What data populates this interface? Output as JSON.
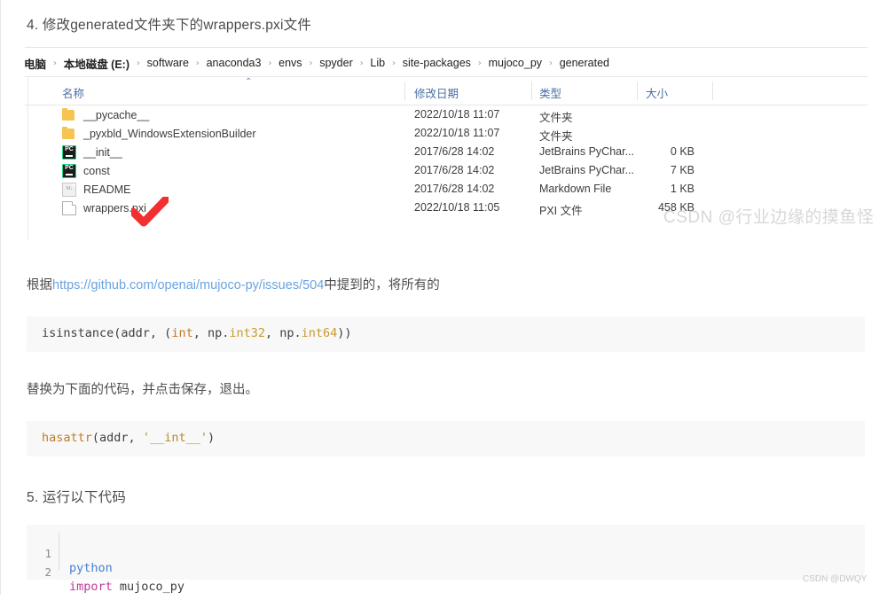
{
  "headings": {
    "step4": "4. 修改generated文件夹下的wrappers.pxi文件",
    "step5": "5. 运行以下代码"
  },
  "explorer": {
    "breadcrumb": {
      "root": "电脑",
      "separator": "›",
      "items": [
        "本地磁盘 (E:)",
        "software",
        "anaconda3",
        "envs",
        "spyder",
        "Lib",
        "site-packages",
        "mujoco_py",
        "generated"
      ]
    },
    "columns": {
      "name": "名称",
      "date": "修改日期",
      "type": "类型",
      "size": "大小",
      "sort_caret": "⌃"
    },
    "rows": [
      {
        "icon": "folder-icon",
        "name": "__pycache__",
        "date": "2022/10/18 11:07",
        "type": "文件夹",
        "size": ""
      },
      {
        "icon": "folder-icon",
        "name": "_pyxbld_WindowsExtensionBuilder",
        "date": "2022/10/18 11:07",
        "type": "文件夹",
        "size": ""
      },
      {
        "icon": "pycharm-file-icon",
        "name": "__init__",
        "date": "2017/6/28 14:02",
        "type": "JetBrains PyChar...",
        "size": "0 KB"
      },
      {
        "icon": "pycharm-file-icon",
        "name": "const",
        "date": "2017/6/28 14:02",
        "type": "JetBrains PyChar...",
        "size": "7 KB"
      },
      {
        "icon": "markdown-file-icon",
        "name": "README",
        "date": "2017/6/28 14:02",
        "type": "Markdown File",
        "size": "1 KB"
      },
      {
        "icon": "generic-file-icon",
        "name": "wrappers.pxi",
        "date": "2022/10/18 11:05",
        "type": "PXI 文件",
        "size": "458 KB"
      }
    ],
    "annotation_color": "#f23030"
  },
  "paragraphs": {
    "link_line": {
      "prefix": "根据",
      "link_text": "https://github.com/openai/mujoco-py/issues/504",
      "suffix": "中提到的，将所有的",
      "link_color": "#6aa3e0"
    },
    "replace_line": "替换为下面的代码，并点击保存，退出。"
  },
  "code_blocks": {
    "original": {
      "tokens": [
        {
          "text": "isinstance(addr, (",
          "style": "plain"
        },
        {
          "text": "int",
          "style": "builtin"
        },
        {
          "text": ", np.",
          "style": "plain"
        },
        {
          "text": "int32",
          "style": "num"
        },
        {
          "text": ", np.",
          "style": "plain"
        },
        {
          "text": "int64",
          "style": "num"
        },
        {
          "text": "))",
          "style": "plain"
        }
      ],
      "plain_text": "isinstance(addr, (int, np.int32, np.int64))"
    },
    "replacement": {
      "tokens": [
        {
          "text": "hasattr",
          "style": "func"
        },
        {
          "text": "(addr, ",
          "style": "plain"
        },
        {
          "text": "'__int__'",
          "style": "str"
        },
        {
          "text": ")",
          "style": "plain"
        }
      ],
      "plain_text": "hasattr(addr, '__int__')"
    },
    "run": {
      "lines": [
        {
          "number": "1",
          "tokens": [
            {
              "text": "python",
              "style": "blue"
            }
          ]
        },
        {
          "number": "2",
          "tokens": [
            {
              "text": "import",
              "style": "kw"
            },
            {
              "text": " mujoco_py",
              "style": "plain"
            }
          ]
        }
      ]
    }
  },
  "watermarks": {
    "main": "CSDN @行业边缘的摸鱼怪",
    "footer": "CSDN @DWQY"
  }
}
